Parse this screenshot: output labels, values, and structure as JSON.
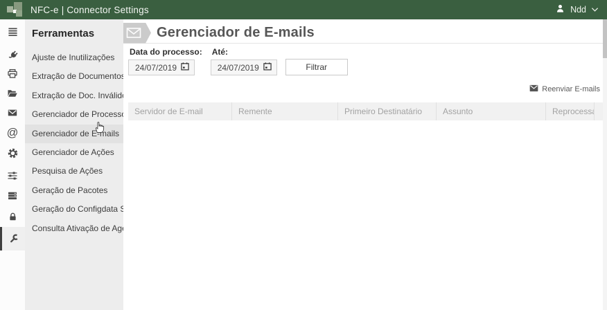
{
  "header": {
    "app_title": "NFC-e | Connector Settings",
    "user_name": "Ndd",
    "icons": [
      "app-logo",
      "user-icon",
      "chevron-down-icon"
    ]
  },
  "colors": {
    "topbar_green": "#3a5f40",
    "sidebar_gray": "#ededed",
    "hover_gray": "#e2e2e2",
    "table_head_bg": "#f1f1f1",
    "table_head_text": "#a2a2a2"
  },
  "icon_rail": {
    "items": [
      "menu-icon",
      "plug-icon",
      "printer-icon",
      "folder-open-icon",
      "envelope-icon",
      "at-sign-icon",
      "gear-icon",
      "sliders-icon",
      "server-icon",
      "lock-icon",
      "wrench-icon"
    ],
    "selected": "wrench-icon"
  },
  "sidebar": {
    "heading": "Ferramentas",
    "items": [
      {
        "label": "Ajuste de Inutilizações"
      },
      {
        "label": "Extração de Documentos"
      },
      {
        "label": "Extração de Doc. Inválidos"
      },
      {
        "label": "Gerenciador de Processos"
      },
      {
        "label": "Gerenciador de E-mails",
        "state": "hovered"
      },
      {
        "label": "Gerenciador de Ações"
      },
      {
        "label": "Pesquisa de Ações"
      },
      {
        "label": "Geração de Pacotes"
      },
      {
        "label": "Geração do Configdata SAT"
      },
      {
        "label": "Consulta Ativação de Agente"
      }
    ]
  },
  "main": {
    "page_title": "Gerenciador de E-mails",
    "title_icon": "envelope-banner-icon",
    "filters": {
      "from_label": "Data do processo:",
      "to_label": "Até:",
      "from_value": "24/07/2019",
      "to_value": "24/07/2019",
      "filter_button": "Filtrar"
    },
    "actions": {
      "resend_label": "Reenviar E-mails",
      "resend_icon": "envelope-icon"
    },
    "table": {
      "columns": [
        "Servidor de E-mail",
        "Remente",
        "Primeiro Destinatário",
        "Assunto",
        "Reprocessável",
        ""
      ],
      "rows": []
    }
  }
}
